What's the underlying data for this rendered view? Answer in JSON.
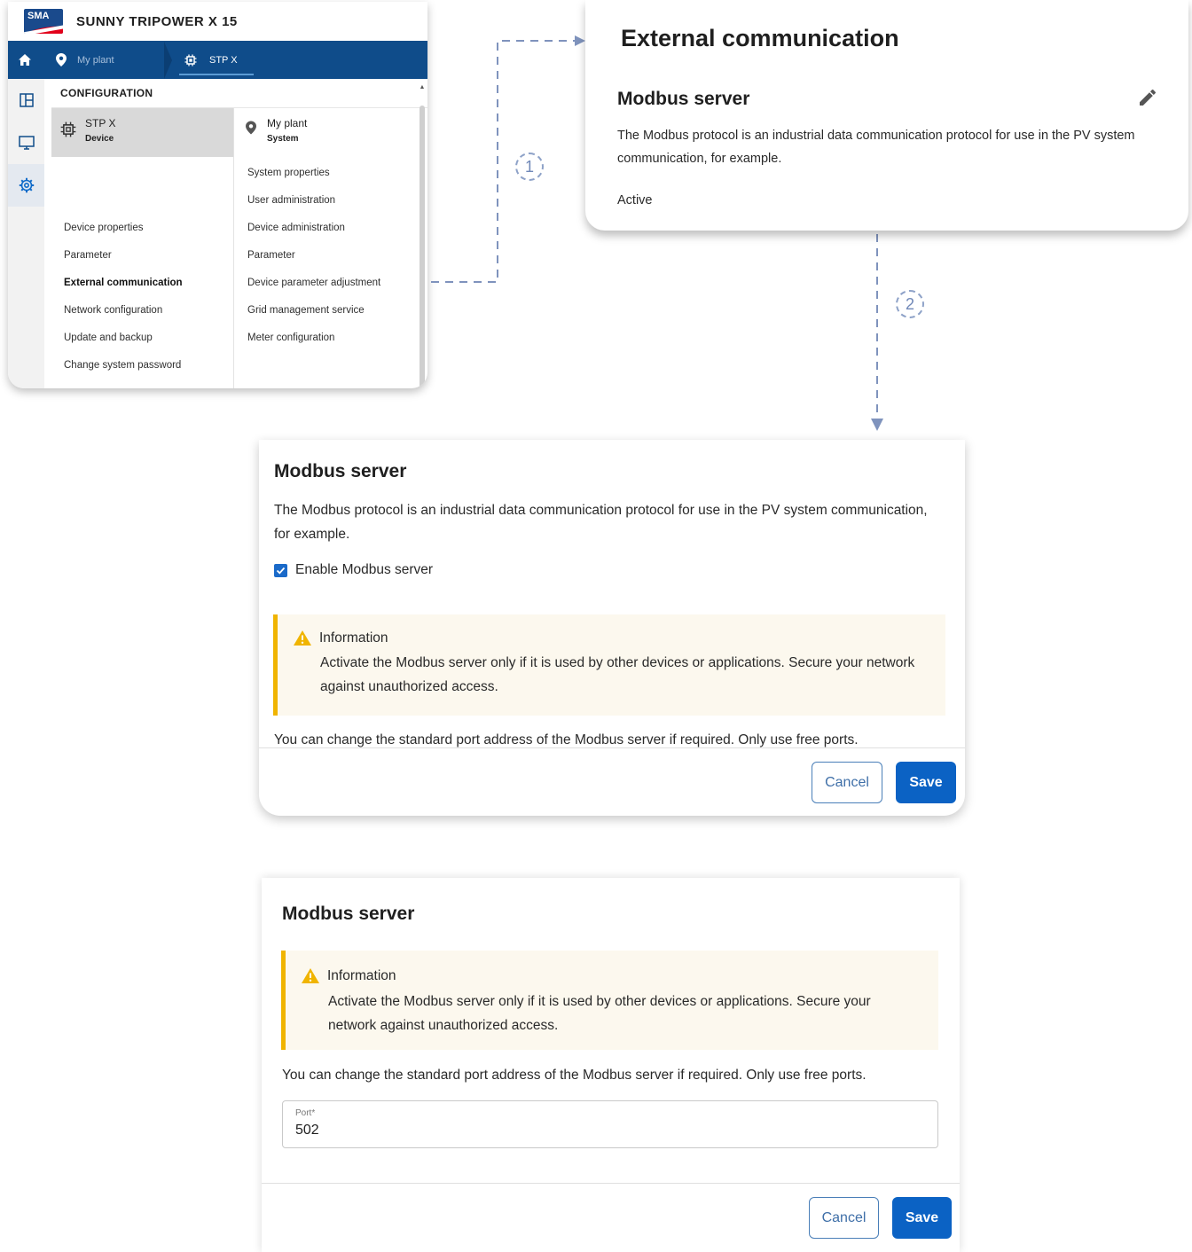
{
  "app": {
    "title": "SUNNY TRIPOWER X 15",
    "logo_text": "SMA",
    "breadcrumb": {
      "plant": "My plant",
      "device": "STP X"
    },
    "config_heading": "CONFIGURATION",
    "device": {
      "name": "STP X",
      "type": "Device"
    },
    "system": {
      "name": "My plant",
      "type": "System"
    },
    "device_menu": [
      {
        "label": "Device properties"
      },
      {
        "label": "Parameter"
      },
      {
        "label": "External communication",
        "active": true
      },
      {
        "label": "Network configuration"
      },
      {
        "label": "Update and backup"
      },
      {
        "label": "Change system password"
      }
    ],
    "system_menu": [
      {
        "label": "System properties"
      },
      {
        "label": "User administration"
      },
      {
        "label": "Device administration"
      },
      {
        "label": "Parameter"
      },
      {
        "label": "Device parameter adjustment"
      },
      {
        "label": "Grid management service"
      },
      {
        "label": "Meter configuration"
      }
    ],
    "colors": {
      "navbar": "#0f4c8a",
      "accent": "#0b62c4",
      "warning": "#f0b400"
    }
  },
  "steps": {
    "one": "1",
    "two": "2"
  },
  "external_card": {
    "title": "External communication",
    "section": "Modbus server",
    "description": "The Modbus protocol is an industrial data communication protocol for use in the PV system communication, for example.",
    "status": "Active"
  },
  "dialog_enable": {
    "title": "Modbus server",
    "description": "The Modbus protocol is an industrial data communication protocol for use in the PV system communication, for example.",
    "checkbox_label": "Enable Modbus server",
    "checkbox_checked": true,
    "info_title": "Information",
    "info_text": "Activate the Modbus server only if it is used by other devices or applications. Secure your network against unauthorized access.",
    "port_hint": "You can change the standard port address of the Modbus server if required. Only use free ports.",
    "cancel": "Cancel",
    "save": "Save"
  },
  "dialog_port": {
    "title": "Modbus server",
    "info_title": "Information",
    "info_text": "Activate the Modbus server only if it is used by other devices or applications. Secure your network against unauthorized access.",
    "port_hint": "You can change the standard port address of the Modbus server if required. Only use free ports.",
    "port_label": "Port*",
    "port_value": "502",
    "cancel": "Cancel",
    "save": "Save"
  }
}
